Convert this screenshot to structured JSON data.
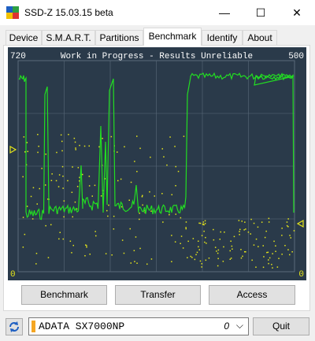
{
  "window": {
    "title": "SSD-Z 15.03.15 beta",
    "minimize": "—",
    "maximize": "☐",
    "close": "✕"
  },
  "tabs": [
    {
      "label": "Device"
    },
    {
      "label": "S.M.A.R.T."
    },
    {
      "label": "Partitions"
    },
    {
      "label": "Benchmark",
      "active": true
    },
    {
      "label": "Identify"
    },
    {
      "label": "About"
    }
  ],
  "graph": {
    "header": "Work in Progress - Results Unreliable",
    "left_max": "720",
    "right_max": "500",
    "left_min": "0",
    "right_min": "0",
    "colors": {
      "background": "#2a3a4a",
      "line": "#22dd22",
      "dots": "#e6e61a",
      "grid": "#5a6a7a",
      "marker": "#e6e61a"
    }
  },
  "buttons": {
    "benchmark": "Benchmark",
    "transfer": "Transfer",
    "access": "Access"
  },
  "drive": {
    "name": "ADATA SX7000NP",
    "index": "0"
  },
  "quit": "Quit"
}
